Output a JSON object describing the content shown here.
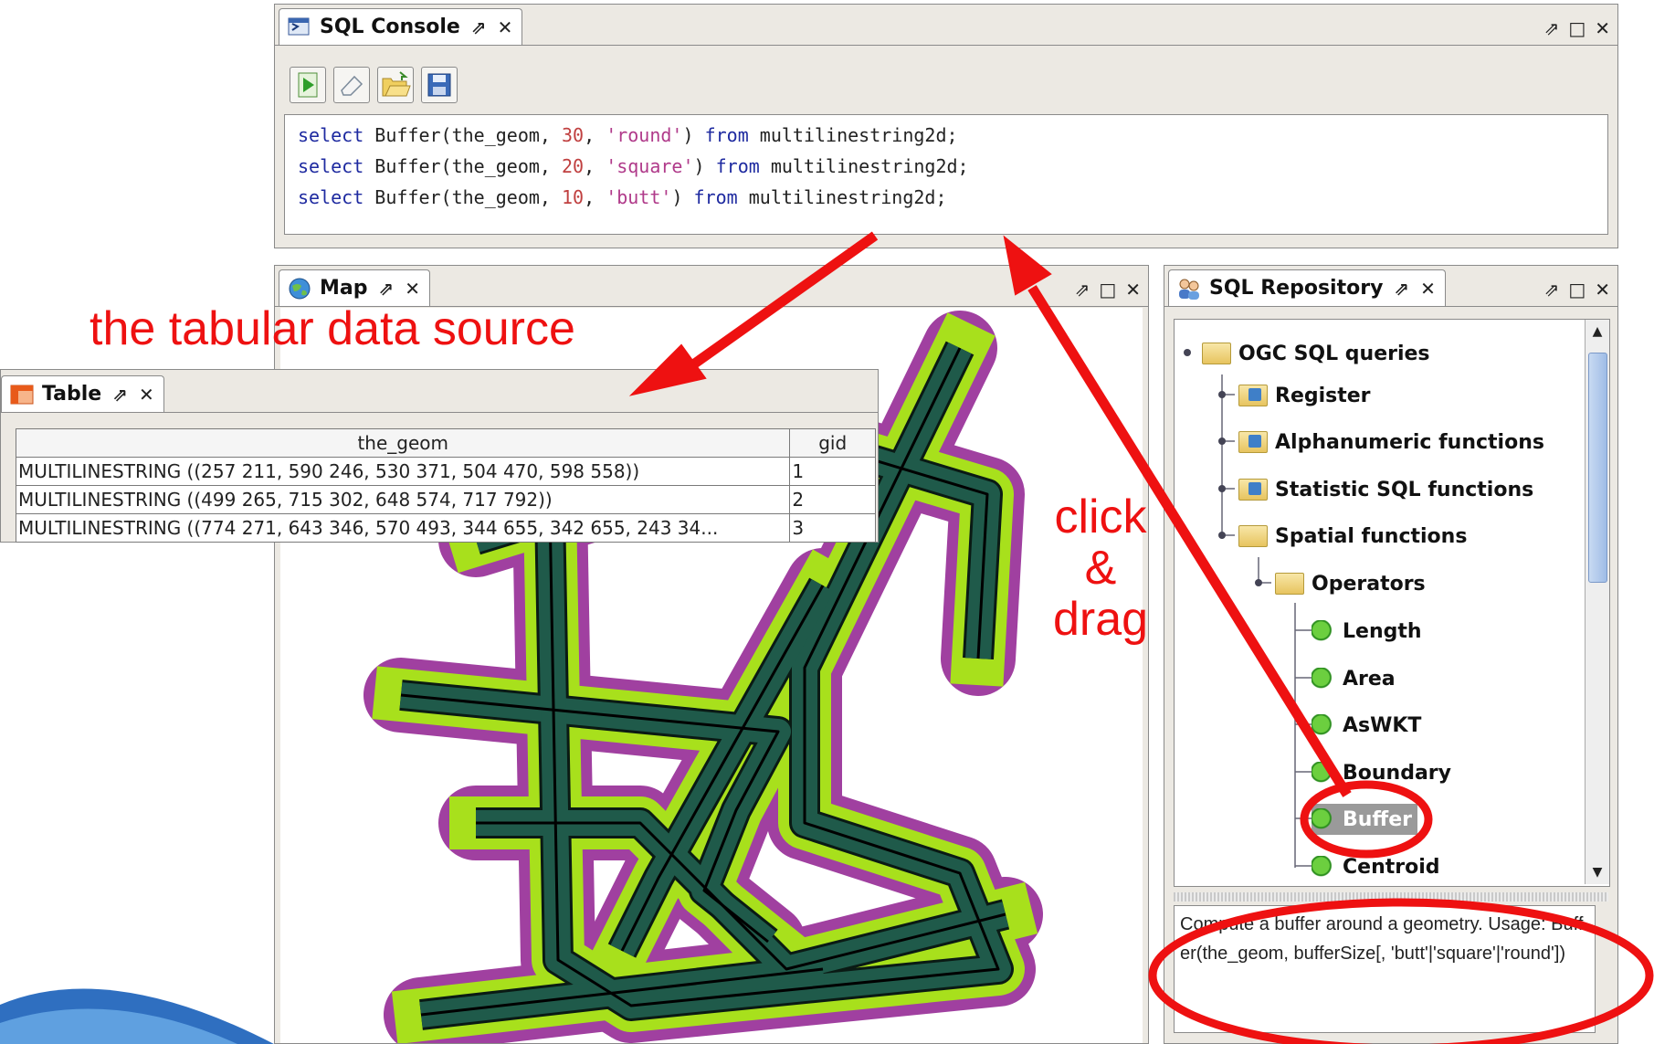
{
  "sql_console": {
    "tab_title": "SQL Console",
    "pin": "⇗",
    "close": "✕",
    "window_controls": [
      "⇗",
      "□",
      "✕"
    ],
    "toolbar": [
      {
        "name": "execute-button",
        "icon": "play-icon"
      },
      {
        "name": "clear-button",
        "icon": "eraser-icon"
      },
      {
        "name": "open-button",
        "icon": "folder-open-icon"
      },
      {
        "name": "save-button",
        "icon": "floppy-icon"
      }
    ],
    "lines": [
      {
        "kw1": "select",
        "fn": " Buffer(the_geom, ",
        "num": "30",
        "sep": ", ",
        "str": "'round'",
        "rp": ") ",
        "kw2": "from",
        "tail": " multilinestring2d;"
      },
      {
        "kw1": "select",
        "fn": " Buffer(the_geom, ",
        "num": "20",
        "sep": ", ",
        "str": "'square'",
        "rp": ") ",
        "kw2": "from",
        "tail": " multilinestring2d;"
      },
      {
        "kw1": "select",
        "fn": " Buffer(the_geom, ",
        "num": "10",
        "sep": ", ",
        "str": "'butt'",
        "rp": ") ",
        "kw2": "from",
        "tail": " multilinestring2d;"
      }
    ]
  },
  "map": {
    "tab_title": "Map",
    "pin": "⇗",
    "close": "✕",
    "window_controls": [
      "⇗",
      "□",
      "✕"
    ]
  },
  "sql_repository": {
    "tab_title": "SQL Repository",
    "pin": "⇗",
    "close": "✕",
    "window_controls": [
      "⇗",
      "□",
      "✕"
    ],
    "tree": [
      {
        "label": "OGC SQL queries",
        "kind": "folder",
        "level": 0
      },
      {
        "label": "Register",
        "kind": "folder2",
        "level": 1
      },
      {
        "label": "Alphanumeric functions",
        "kind": "folder2",
        "level": 1
      },
      {
        "label": "Statistic SQL functions",
        "kind": "folder2",
        "level": 1
      },
      {
        "label": "Spatial functions",
        "kind": "folder",
        "level": 1
      },
      {
        "label": "Operators",
        "kind": "folder",
        "level": 2
      },
      {
        "label": "Length",
        "kind": "leaf",
        "level": 3
      },
      {
        "label": "Area",
        "kind": "leaf",
        "level": 3
      },
      {
        "label": "AsWKT",
        "kind": "leaf",
        "level": 3
      },
      {
        "label": "Boundary",
        "kind": "leaf",
        "level": 3
      },
      {
        "label": "Buffer",
        "kind": "leaf",
        "level": 3,
        "selected": true
      },
      {
        "label": "Centroid",
        "kind": "leaf",
        "level": 3
      }
    ],
    "description": "Compute a buffer around a geometry. Usage: Buffer(the_geom, bufferSize[, 'butt'|'square'|'round'])"
  },
  "table": {
    "tab_title": "Table",
    "pin": "⇗",
    "close": "✕",
    "columns": [
      "the_geom",
      "gid"
    ],
    "rows": [
      [
        "MULTILINESTRING ((257 211, 590 246, 530 371, 504 470, 598 558))",
        "1"
      ],
      [
        "MULTILINESTRING ((499 265, 715 302, 648 574, 717 792))",
        "2"
      ],
      [
        "MULTILINESTRING ((774 271, 643 346, 570 493, 344 655, 342 655, 243 34...",
        "3"
      ]
    ]
  },
  "annotations": {
    "tabular_label": "the tabular data source",
    "drag_line1": "click",
    "drag_line2": "&",
    "drag_line3": "drag"
  },
  "colors": {
    "arrow_red": "#ee1111",
    "buffer_purple": "#a040a0",
    "buffer_lime": "#a8e01c",
    "buffer_teal": "#1f5a4a"
  }
}
